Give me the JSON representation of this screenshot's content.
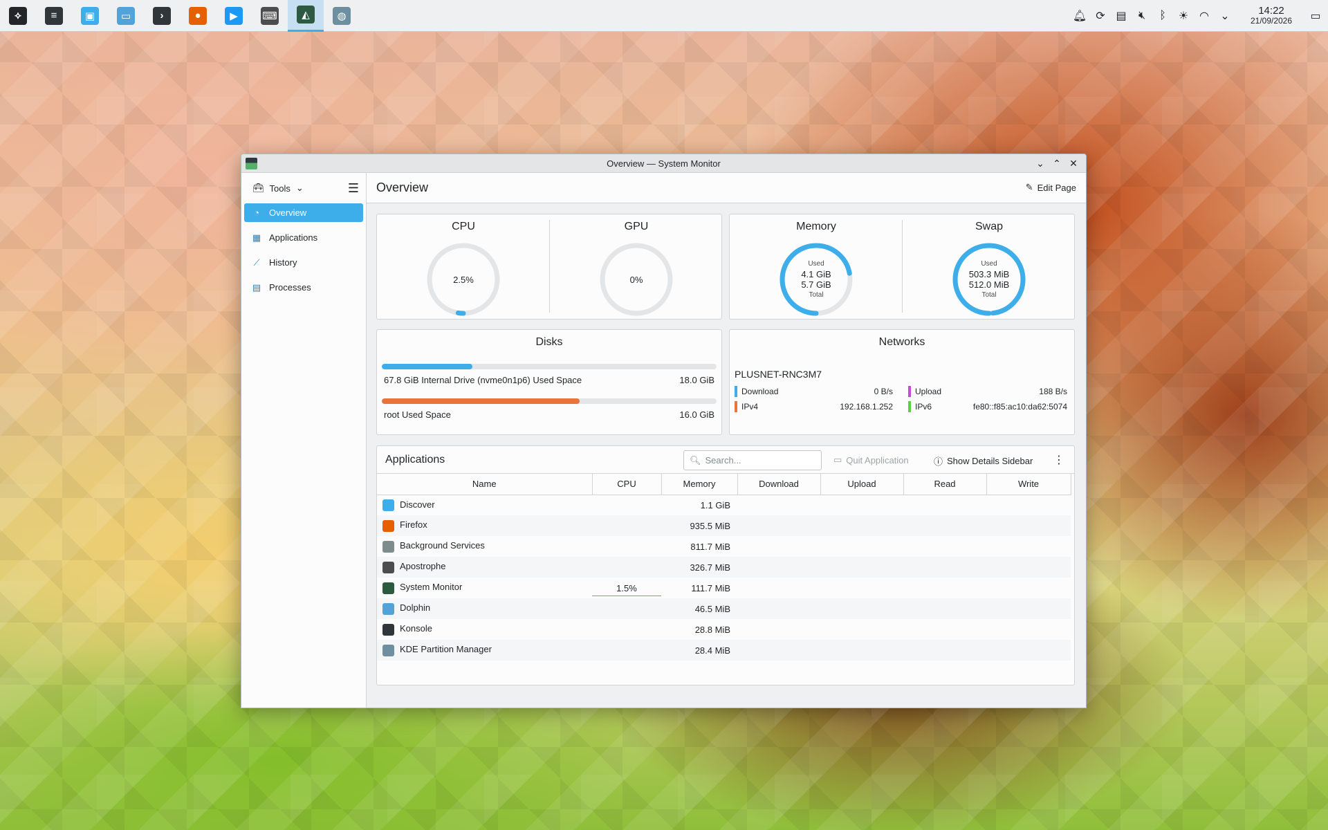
{
  "taskbar": {
    "apps": [
      {
        "name": "launcher",
        "icon": "application-launcher-icon",
        "glyph": "⟡",
        "color": "#232629"
      },
      {
        "name": "system-settings",
        "icon": "system-settings-icon",
        "glyph": "≡",
        "color": "#31363b"
      },
      {
        "name": "discover",
        "icon": "discover-icon",
        "glyph": "▣",
        "color": "#3daee9"
      },
      {
        "name": "dolphin",
        "icon": "dolphin-icon",
        "glyph": "▭",
        "color": "#54a3d8"
      },
      {
        "name": "konsole",
        "icon": "konsole-icon",
        "glyph": "›",
        "color": "#31363b"
      },
      {
        "name": "firefox",
        "icon": "firefox-icon",
        "glyph": "●",
        "color": "#e66000"
      },
      {
        "name": "media-player",
        "icon": "media-player-icon",
        "glyph": "▶",
        "color": "#1d99f3"
      },
      {
        "name": "apostrophe",
        "icon": "apostrophe-icon",
        "glyph": "⌨",
        "color": "#4d4d4d"
      },
      {
        "name": "system-monitor",
        "icon": "system-monitor-icon",
        "glyph": "◭",
        "color": "#2d5a40"
      },
      {
        "name": "partition-manager",
        "icon": "partition-manager-icon",
        "glyph": "◍",
        "color": "#6d8f9f"
      }
    ],
    "clock": {
      "time": "14:22",
      "date": "21/09/2026"
    }
  },
  "window": {
    "title": "Overview — System Monitor",
    "sidebar": {
      "tools_label": "Tools",
      "items": [
        {
          "label": "Overview",
          "icon": "overview-icon",
          "glyph": "◔",
          "active": true
        },
        {
          "label": "Applications",
          "icon": "applications-icon",
          "glyph": "▦",
          "active": false
        },
        {
          "label": "History",
          "icon": "history-icon",
          "glyph": "⟋",
          "active": false
        },
        {
          "label": "Processes",
          "icon": "processes-icon",
          "glyph": "▤",
          "active": false
        }
      ]
    },
    "page_title": "Overview",
    "edit_page_label": "Edit Page",
    "cpu": {
      "title": "CPU",
      "value": "2.5%",
      "fraction": 0.025
    },
    "gpu": {
      "title": "GPU",
      "value": "0%",
      "fraction": 0
    },
    "memory": {
      "title": "Memory",
      "used_label": "Used",
      "used": "4.1 GiB",
      "total": "5.7 GiB",
      "total_label": "Total",
      "fraction": 0.72
    },
    "swap": {
      "title": "Swap",
      "used_label": "Used",
      "used": "503.3 MiB",
      "total": "512.0 MiB",
      "total_label": "Total",
      "fraction": 0.98
    },
    "disks": {
      "title": "Disks",
      "items": [
        {
          "label": "67.8 GiB Internal Drive (nvme0n1p6) Used Space",
          "value": "18.0 GiB",
          "fraction": 0.27,
          "color": "#3daee9"
        },
        {
          "label": "root Used Space",
          "value": "16.0 GiB",
          "fraction": 0.59,
          "color": "#e8743b"
        }
      ]
    },
    "networks": {
      "title": "Networks",
      "name": "PLUSNET-RNC3M7",
      "download_label": "Download",
      "download": "0 B/s",
      "download_color": "#3daee9",
      "upload_label": "Upload",
      "upload": "188 B/s",
      "upload_color": "#c94ad9",
      "ipv4_label": "IPv4",
      "ipv4": "192.168.1.252",
      "ipv4_color": "#e8743b",
      "ipv6_label": "IPv6",
      "ipv6": "fe80::f85:ac10:da62:5074",
      "ipv6_color": "#5ad13f"
    },
    "applications": {
      "title": "Applications",
      "search_placeholder": "Search...",
      "quit_label": "Quit Application",
      "details_label": "Show Details Sidebar",
      "columns": [
        "Name",
        "CPU",
        "Memory",
        "Download",
        "Upload",
        "Read",
        "Write"
      ],
      "rows": [
        {
          "name": "Discover",
          "cpu": "",
          "memory": "1.1 GiB",
          "icon": "discover-icon",
          "color": "#3daee9"
        },
        {
          "name": "Firefox",
          "cpu": "",
          "memory": "935.5 MiB",
          "icon": "firefox-icon",
          "color": "#e66000"
        },
        {
          "name": "Background Services",
          "cpu": "",
          "memory": "811.7 MiB",
          "icon": "background-services-icon",
          "color": "#7f8c8d"
        },
        {
          "name": "Apostrophe",
          "cpu": "",
          "memory": "326.7 MiB",
          "icon": "apostrophe-icon",
          "color": "#4d4d4d"
        },
        {
          "name": "System Monitor",
          "cpu": "1.5%",
          "memory": "111.7 MiB",
          "icon": "system-monitor-icon",
          "color": "#2d5a40"
        },
        {
          "name": "Dolphin",
          "cpu": "",
          "memory": "46.5 MiB",
          "icon": "dolphin-icon",
          "color": "#54a3d8"
        },
        {
          "name": "Konsole",
          "cpu": "",
          "memory": "28.8 MiB",
          "icon": "konsole-icon",
          "color": "#31363b"
        },
        {
          "name": "KDE Partition Manager",
          "cpu": "",
          "memory": "28.4 MiB",
          "icon": "partition-manager-icon",
          "color": "#6d8f9f"
        }
      ]
    }
  },
  "colors": {
    "accent": "#3daee9",
    "gauge_track": "#e4e5e7"
  }
}
